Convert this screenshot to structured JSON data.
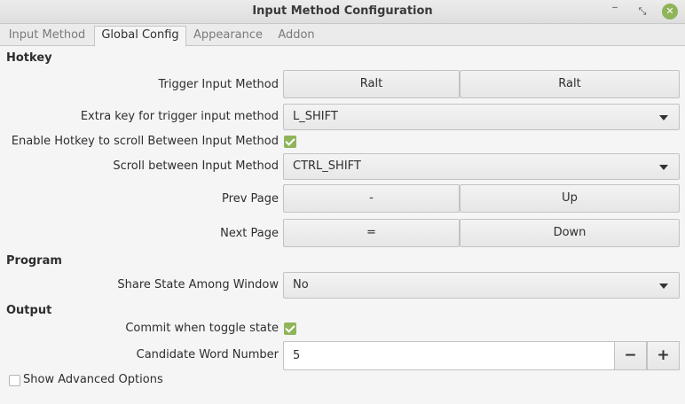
{
  "window": {
    "title": "Input Method Configuration",
    "minimize_glyph": "‾",
    "maximize_glyph": "⤡",
    "close_glyph": "✕"
  },
  "tabs": [
    {
      "label": "Input Method"
    },
    {
      "label": "Global Config"
    },
    {
      "label": "Appearance"
    },
    {
      "label": "Addon"
    }
  ],
  "active_tab": "Global Config",
  "hotkey": {
    "heading": "Hotkey",
    "trigger": {
      "label": "Trigger Input Method",
      "key1": "Ralt",
      "key2": "Ralt"
    },
    "extra_key": {
      "label": "Extra key for trigger input method",
      "value": "L_SHIFT"
    },
    "enable_scroll": {
      "label": "Enable Hotkey to scroll Between Input Method",
      "checked": true
    },
    "scroll_between": {
      "label": "Scroll between Input Method",
      "value": "CTRL_SHIFT"
    },
    "prev_page": {
      "label": "Prev Page",
      "key1": "-",
      "key2": "Up"
    },
    "next_page": {
      "label": "Next Page",
      "key1": "=",
      "key2": "Down"
    }
  },
  "program": {
    "heading": "Program",
    "share_state": {
      "label": "Share State Among Window",
      "value": "No"
    }
  },
  "output": {
    "heading": "Output",
    "commit_toggle": {
      "label": "Commit when toggle state",
      "checked": true
    },
    "candidate_number": {
      "label": "Candidate Word Number",
      "value": "5",
      "minus": "−",
      "plus": "+"
    }
  },
  "advanced": {
    "label": "Show Advanced Options",
    "checked": false
  },
  "colors": {
    "accent": "#8fb45a",
    "background": "#f5f5f5"
  }
}
